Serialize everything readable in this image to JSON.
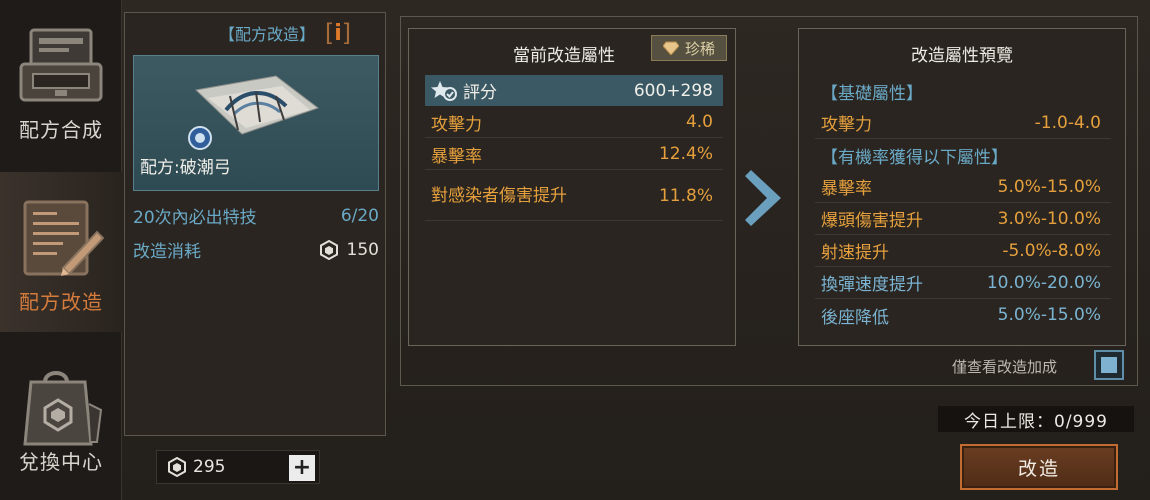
{
  "nav": {
    "items": [
      {
        "label": "配方合成",
        "icon": "printer-icon",
        "active": false
      },
      {
        "label": "配方改造",
        "icon": "blueprint-edit-icon",
        "active": true
      },
      {
        "label": "兌換中心",
        "icon": "shopping-bag-icon",
        "active": false
      }
    ]
  },
  "recipe": {
    "panel_title": "【配方改造】",
    "info_icon": "i",
    "name": "配方:破潮弓",
    "guarantee_label": "20次內必出特技",
    "guarantee_progress": "6/20",
    "cost_label": "改造消耗",
    "cost_value": "150",
    "currency_amount": "295",
    "plus_label": "+"
  },
  "current": {
    "title": "當前改造屬性",
    "rarity_badge": "珍稀",
    "score_label": "評分",
    "score_value": "600+298",
    "rows": [
      {
        "name": "攻擊力",
        "value": "4.0"
      },
      {
        "name": "暴擊率",
        "value": "12.4%"
      },
      {
        "name": "對感染者傷害提升",
        "value": "11.8%"
      }
    ]
  },
  "preview": {
    "title": "改造屬性預覽",
    "base_header": "【基礎屬性】",
    "base_rows": [
      {
        "name": "攻擊力",
        "value": "-1.0-4.0"
      }
    ],
    "chance_header": "【有機率獲得以下屬性】",
    "chance_rows": [
      {
        "name": "暴擊率",
        "value": "5.0%-15.0%",
        "color": "orange"
      },
      {
        "name": "爆頭傷害提升",
        "value": "3.0%-10.0%",
        "color": "orange"
      },
      {
        "name": "射速提升",
        "value": "-5.0%-8.0%",
        "color": "orange"
      },
      {
        "name": "換彈速度提升",
        "value": "10.0%-20.0%",
        "color": "blue"
      },
      {
        "name": "後座降低",
        "value": "5.0%-15.0%",
        "color": "blue"
      }
    ]
  },
  "options": {
    "only_view_label": "僅查看改造加成",
    "only_view_checked": true
  },
  "footer": {
    "daily_limit": "今日上限：0/999",
    "craft_button": "改造"
  },
  "colors": {
    "accent_orange": "#e5a03d",
    "accent_blue": "#6aa9c6",
    "button_border": "#c26c32"
  }
}
